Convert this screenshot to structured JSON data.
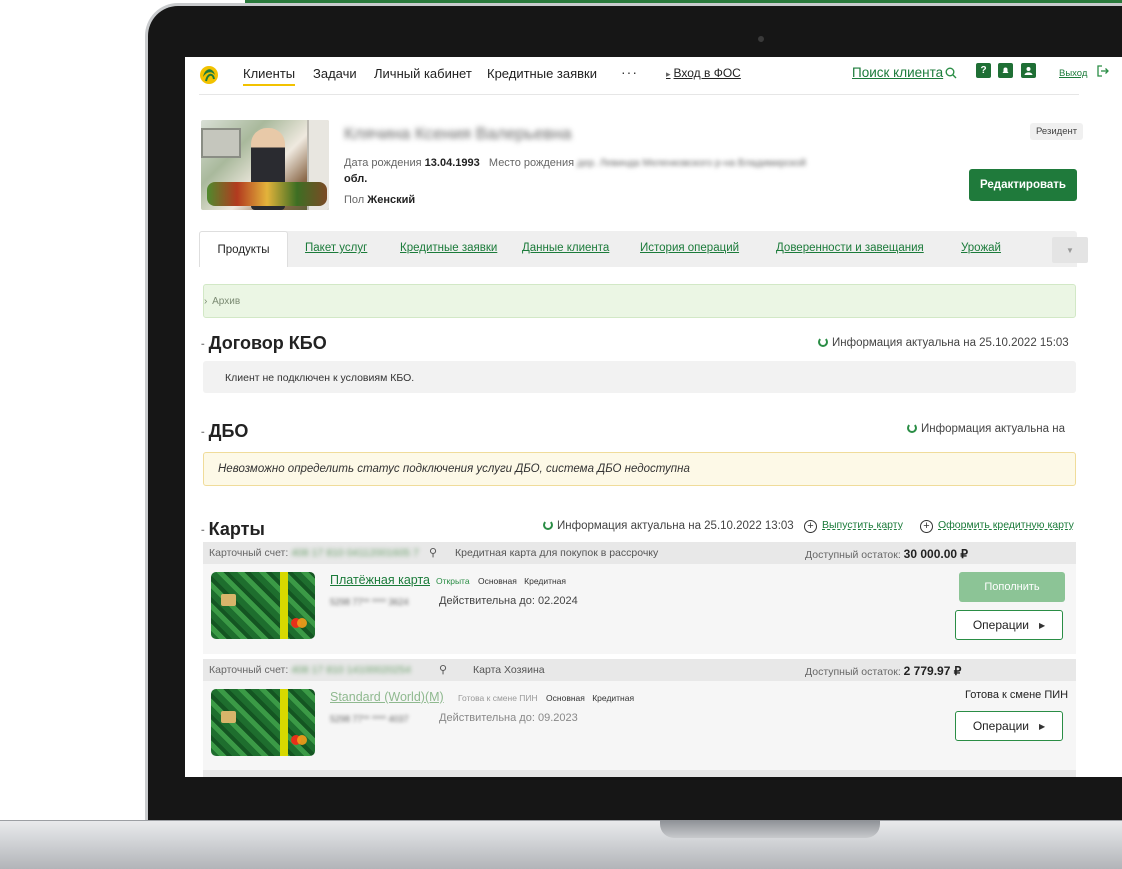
{
  "colors": {
    "brand_green": "#1f7a3b",
    "link_green": "#1b7b3a",
    "active_tab_underline": "#f2c200",
    "warning_bg": "#fdf9e7",
    "archive_bg": "#ebf6e4"
  },
  "nav": {
    "items": [
      "Клиенты",
      "Задачи",
      "Личный кабинет",
      "Кредитные заявки"
    ],
    "more": "···",
    "fos_link": "Вход в ФОС",
    "search_link": "Поиск клиента",
    "help_icon_label": "?",
    "exit_link": "Выход"
  },
  "client": {
    "name": "Клячина Ксения Валерьевна",
    "dob_label": "Дата рождения",
    "dob": "13.04.1993",
    "birthplace_label": "Место рождения",
    "birthplace": "дер. Левинда Меленковского р-на Владимирской",
    "birthplace_cont": "обл.",
    "sex_label": "Пол",
    "sex": "Женский",
    "resident_badge": "Резидент",
    "edit_button": "Редактировать"
  },
  "tabs": {
    "items": [
      "Продукты",
      "Пакет услуг",
      "Кредитные заявки",
      "Данные клиента",
      "История операций",
      "Доверенности и завещания",
      "Урожай"
    ],
    "more_icon": "▼"
  },
  "archive": {
    "label": "Архив"
  },
  "kbo": {
    "title": "Договор КБО",
    "info": "Информация актуальна на 25.10.2022 15:03",
    "message": "Клиент не подключен к условиям КБО."
  },
  "dbo": {
    "title": "ДБО",
    "info": "Информация актуальна на",
    "warning": "Невозможно определить статус подключения услуги ДБО, система ДБО недоступна"
  },
  "cards": {
    "title": "Карты",
    "info": "Информация актуальна на 25.10.2022 13:03",
    "issue_card": "Выпустить карту",
    "issue_credit_card": "Оформить кредитную карту",
    "groups": [
      {
        "account_label": "Карточный счет:",
        "account_number": "408 17 810 04112001605 7",
        "description": "Кредитная карта для покупок в рассрочку",
        "balance_label": "Доступный остаток:",
        "balance": "30 000.00 ₽",
        "card_name": "Платёжная карта",
        "status": "Открыта",
        "tags": [
          "Основная",
          "Кредитная"
        ],
        "card_number": "5298 77** **** 3624",
        "valid_label": "Действительна до:",
        "valid_until": "02.2024",
        "topup_button": "Пополнить",
        "ops_button": "Операции"
      },
      {
        "account_label": "Карточный счет:",
        "account_number": "408 17 810 14100020254",
        "description": "Карта Хозяина",
        "balance_label": "Доступный остаток:",
        "balance": "2 779.97 ₽",
        "card_name": "Standard (World)(M)",
        "status": "Готова к смене ПИН",
        "tags": [
          "Основная",
          "Кредитная"
        ],
        "card_number": "5298 77** **** 4037",
        "valid_label": "Действительна до:",
        "valid_until": "09.2023",
        "pin_status": "Готова к смене ПИН",
        "ops_button": "Операции"
      }
    ]
  }
}
